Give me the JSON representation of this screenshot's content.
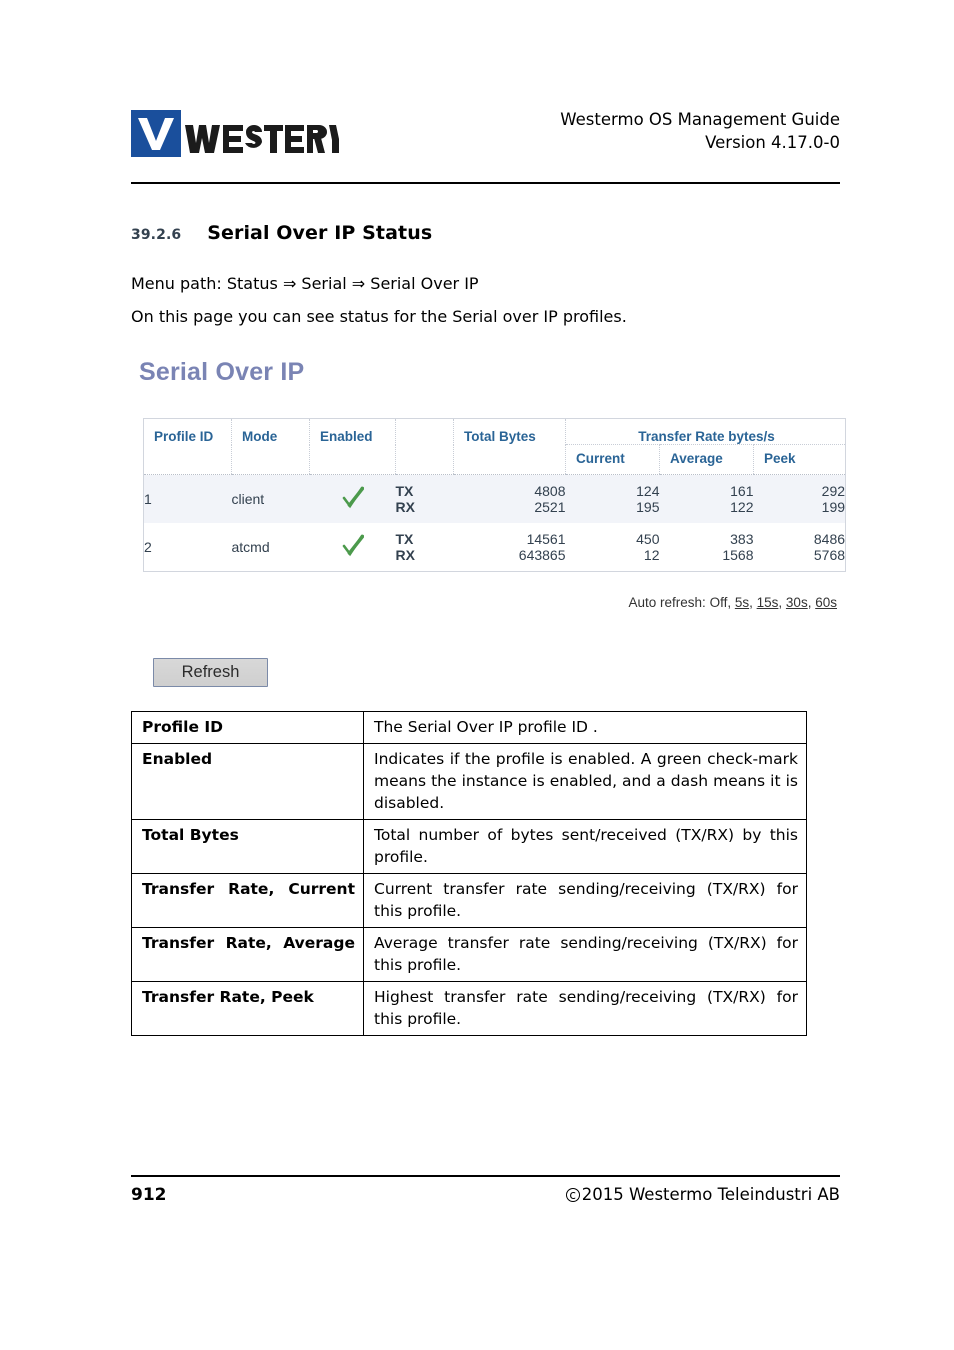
{
  "header": {
    "logo_alt": "westermo",
    "logo_registered": "®",
    "logo_wordmark": "westermo",
    "doc_title": "Westermo OS Management Guide",
    "doc_version": "Version 4.17.0-0"
  },
  "section": {
    "number": "39.2.6",
    "title": "Serial Over IP Status",
    "menu_path": "Menu path: Status ⇒ Serial ⇒ Serial Over IP",
    "intro": "On this page you can see status for the Serial over IP profiles."
  },
  "screenshot": {
    "title": "Serial Over IP",
    "title_color": "#7a84b4",
    "columns": {
      "profile_id": "Profile ID",
      "mode": "Mode",
      "enabled": "Enabled",
      "direction": "",
      "total_bytes": "Total Bytes",
      "transfer_rate_group": "Transfer Rate bytes/s",
      "current": "Current",
      "average": "Average",
      "peek": "Peek"
    },
    "rows": [
      {
        "profile_id": "1",
        "mode": "client",
        "enabled_icon": "green-check-icon",
        "tx": {
          "label": "TX",
          "total_bytes": "4808",
          "current": "124",
          "average": "161",
          "peek": "292"
        },
        "rx": {
          "label": "RX",
          "total_bytes": "2521",
          "current": "195",
          "average": "122",
          "peek": "199"
        }
      },
      {
        "profile_id": "2",
        "mode": "atcmd",
        "enabled_icon": "green-check-icon",
        "tx": {
          "label": "TX",
          "total_bytes": "14561",
          "current": "450",
          "average": "383",
          "peek": "8486"
        },
        "rx": {
          "label": "RX",
          "total_bytes": "643865",
          "current": "12",
          "average": "1568",
          "peek": "5768"
        }
      }
    ],
    "auto_refresh": {
      "label": "Auto refresh:",
      "off": "Off",
      "options": [
        "5s",
        "15s",
        "30s",
        "60s"
      ],
      "separator": ", "
    },
    "refresh_button": "Refresh",
    "check_color": "#4c9a4c",
    "header_text_color": "#2a6496",
    "stripe_color": "#f2f4f9"
  },
  "description_table": {
    "rows": [
      {
        "term": "Profile ID",
        "definition": "The Serial Over IP profile ID ."
      },
      {
        "term": "Enabled",
        "definition": "Indicates if the profile is enabled. A green check-mark means the instance is enabled, and a dash means it is disabled."
      },
      {
        "term": "Total Bytes",
        "definition": "Total number of bytes sent/received (TX/RX) by this profile."
      },
      {
        "term": "Transfer Rate, Current",
        "definition": "Current transfer rate sending/receiving (TX/RX) for this profile."
      },
      {
        "term": "Transfer Rate, Average",
        "definition": "Average transfer rate sending/receiving (TX/RX) for this profile."
      },
      {
        "term": "Transfer Rate, Peek",
        "definition": "Highest transfer rate sending/receiving (TX/RX) for this profile."
      }
    ]
  },
  "footer": {
    "page_number": "912",
    "copyright_symbol": "c",
    "copyright_text": "2015 Westermo Teleindustri AB"
  }
}
